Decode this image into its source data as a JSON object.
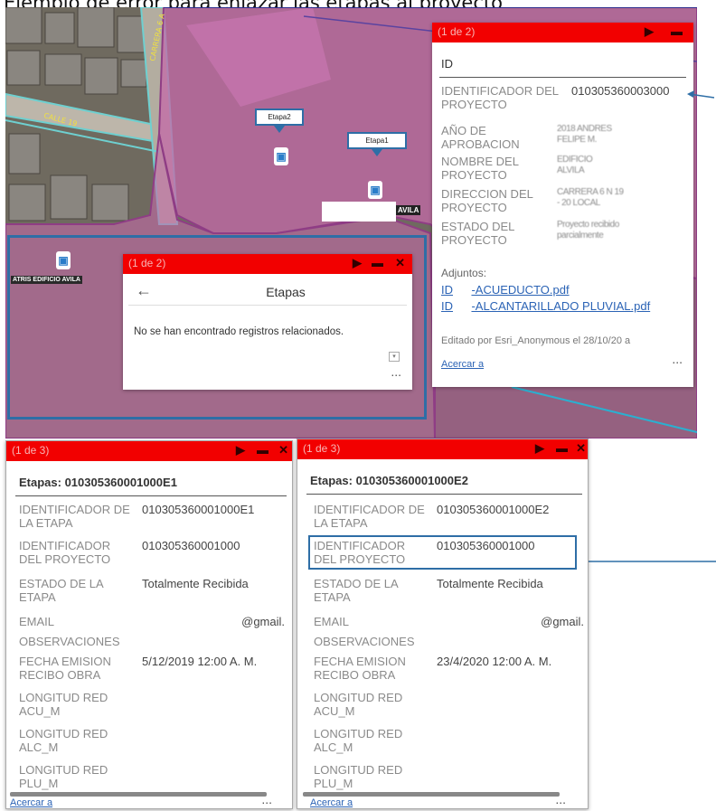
{
  "title": "Ejemplo de error para enlazar las etapas al proyecto",
  "map": {
    "street_a": "CALLE 19",
    "street_b": "CARRERA 6 A",
    "callout_etapa2": "Etapa2",
    "callout_etapa1": "Etapa1",
    "label_edificio": "ATRIS EDIFICIO AVILA",
    "label_avila": "AVILA"
  },
  "project_popup": {
    "counter": "(1 de 2)",
    "header": "ID",
    "fields": [
      {
        "label": "IDENTIFICADOR DEL PROYECTO",
        "value": "010305360003000"
      },
      {
        "label": "AÑO DE APROBACION",
        "value": "2018 ANDRES FELIPE M."
      },
      {
        "label": "NOMBRE DEL PROYECTO",
        "value": "EDIFICIO ALVILA"
      },
      {
        "label": "DIRECCION DEL PROYECTO",
        "value": "CARRERA 6 N 19 - 20 LOCAL"
      },
      {
        "label": "ESTADO DEL PROYECTO",
        "value": "Proyecto recibido parcialmente"
      }
    ],
    "attachments_label": "Adjuntos:",
    "attachments": [
      {
        "id": "ID",
        "name": "-ACUEDUCTO.pdf"
      },
      {
        "id": "ID",
        "name": "-ALCANTARILLADO PLUVIAL.pdf"
      }
    ],
    "edited": "Editado por Esri_Anonymous el 28/10/20 a",
    "zoom_link": "Acercar a",
    "more": "..."
  },
  "etapas_popup": {
    "counter": "(1 de 2)",
    "title": "Etapas",
    "message": "No se han encontrado registros relacionados.",
    "more": "..."
  },
  "stage1": {
    "counter": "(1 de 3)",
    "header": "Etapas: 010305360001000E1",
    "fields": [
      {
        "label": "IDENTIFICADOR DE LA ETAPA",
        "value": "010305360001000E1"
      },
      {
        "label": "IDENTIFICADOR DEL PROYECTO",
        "value": "010305360001000"
      },
      {
        "label": "ESTADO DE LA ETAPA",
        "value": "Totalmente Recibida"
      },
      {
        "label": "EMAIL",
        "value": "@gmail."
      },
      {
        "label": "OBSERVACIONES",
        "value": ""
      },
      {
        "label": "FECHA EMISION RECIBO OBRA",
        "value": "5/12/2019 12:00 A. M."
      },
      {
        "label": "LONGITUD RED ACU_M",
        "value": ""
      },
      {
        "label": "LONGITUD RED ALC_M",
        "value": ""
      },
      {
        "label": "LONGITUD RED PLU_M",
        "value": ""
      }
    ],
    "zoom_link": "Acercar a",
    "more": "..."
  },
  "stage2": {
    "counter": "(1 de 3)",
    "header": "Etapas: 010305360001000E2",
    "fields": [
      {
        "label": "IDENTIFICADOR DE LA ETAPA",
        "value": "010305360001000E2"
      },
      {
        "label": "IDENTIFICADOR DEL PROYECTO",
        "value": "010305360001000"
      },
      {
        "label": "ESTADO DE LA ETAPA",
        "value": "Totalmente Recibida"
      },
      {
        "label": "EMAIL",
        "value": "@gmail."
      },
      {
        "label": "OBSERVACIONES",
        "value": ""
      },
      {
        "label": "FECHA EMISION RECIBO OBRA",
        "value": "23/4/2020 12:00 A. M."
      },
      {
        "label": "LONGITUD RED ACU_M",
        "value": ""
      },
      {
        "label": "LONGITUD RED ALC_M",
        "value": ""
      },
      {
        "label": "LONGITUD RED PLU_M",
        "value": ""
      }
    ],
    "zoom_link": "Acercar a",
    "more": "..."
  },
  "colors": {
    "header_red": "#f20000",
    "highlight_blue": "#2e6ea6",
    "parcel_pink": "#c46aa8"
  }
}
